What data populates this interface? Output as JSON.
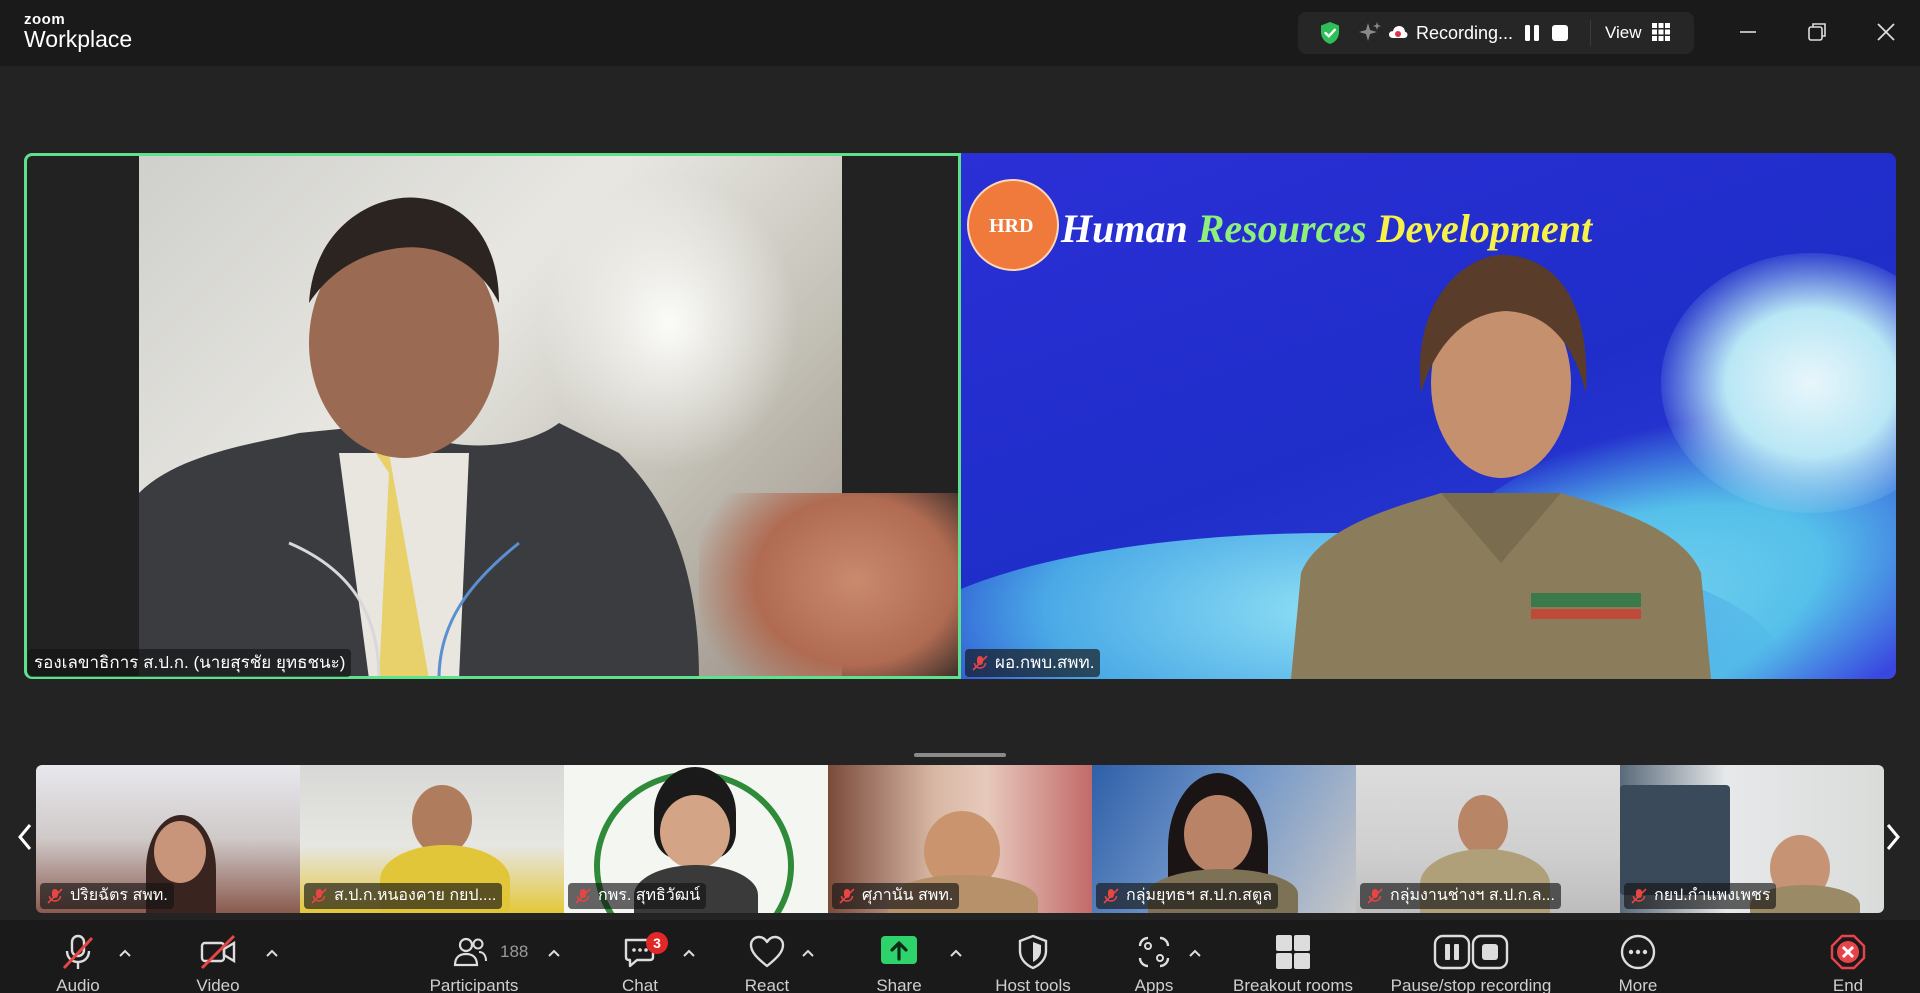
{
  "app": {
    "logo_top": "zoom",
    "logo_bottom": "Workplace"
  },
  "recording": {
    "status_text": "Recording...",
    "view_label": "View"
  },
  "main": {
    "left_name": "รองเลขาธิการ ส.ป.ก. (นายสุรชัย ยุทธชนะ)",
    "right_name": "ผอ.กพบ.สพท.",
    "banner": {
      "w1": "Human",
      "w2": "Resources",
      "w3": "Development",
      "badge": "HRD"
    }
  },
  "thumbnails": [
    {
      "name": "ปริยฉัตร สพท."
    },
    {
      "name": "ส.ป.ก.หนองคาย กยป...."
    },
    {
      "name": "กพร. สุทธิวัฒน์"
    },
    {
      "name": "ศุภานัน สพท."
    },
    {
      "name": "กลุ่มยุทธฯ ส.ป.ก.สตูล"
    },
    {
      "name": "กลุ่มงานช่างฯ ส.ป.ก.ล..."
    },
    {
      "name": "กยป.กำแพงเพชร"
    }
  ],
  "toolbar": {
    "audio": "Audio",
    "video": "Video",
    "participants": "Participants",
    "participants_count": "188",
    "chat": "Chat",
    "chat_badge": "3",
    "react": "React",
    "share": "Share",
    "host_tools": "Host tools",
    "apps": "Apps",
    "breakout": "Breakout rooms",
    "pause_stop": "Pause/stop recording",
    "more": "More",
    "end": "End"
  },
  "colors": {
    "active_speaker": "#5fe08a",
    "share_green": "#2ed36b",
    "end_red": "#e8434a",
    "badge_red": "#e02828"
  }
}
